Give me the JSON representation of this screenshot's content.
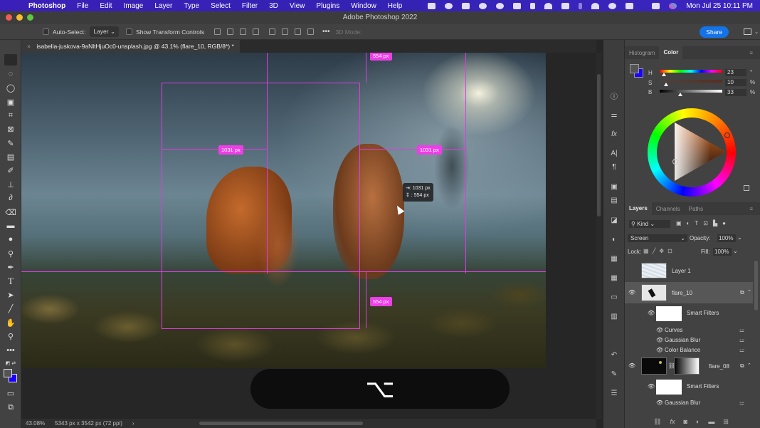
{
  "menubar": {
    "app_name": "Photoshop",
    "items": [
      "File",
      "Edit",
      "Image",
      "Layer",
      "Type",
      "Select",
      "Filter",
      "3D",
      "View",
      "Plugins",
      "Window",
      "Help"
    ],
    "datetime": "Mon Jul 25  10:11 PM"
  },
  "window": {
    "title": "Adobe Photoshop 2022"
  },
  "options_bar": {
    "auto_select_label": "Auto-Select:",
    "auto_select_target": "Layer",
    "show_transform_label": "Show Transform Controls",
    "mode_3d_label": "3D Mode:",
    "share_label": "Share"
  },
  "document": {
    "tab_title": "isabella-juskova-9aNltHjuOc0-unsplash.jpg @ 43.1% (flare_10, RGB/8*) *",
    "close": "×"
  },
  "measurements": {
    "top": "554 px",
    "left": "1031 px",
    "right": "1031 px",
    "bottom": "554 px",
    "tooltip_w": "⇥: 1031 px",
    "tooltip_h": "↧ :  554 px"
  },
  "key_overlay": {
    "glyph": "⌥"
  },
  "statusbar": {
    "zoom": "43.08%",
    "dimensions": "5343 px x 3542 px (72 ppi)",
    "arrow": "›"
  },
  "color_panel": {
    "tabs": [
      "Histogram",
      "Color"
    ],
    "active_tab": "Color",
    "h_label": "H",
    "s_label": "S",
    "b_label": "B",
    "h": "23",
    "s": "10",
    "b": "33",
    "h_unit": "°",
    "s_unit": "%",
    "b_unit": "%",
    "h_fraction": 0.064,
    "s_fraction": 0.1,
    "b_fraction": 0.33,
    "foreground": "#545454",
    "background": "#1a00ff"
  },
  "layers_panel": {
    "tabs": [
      "Layers",
      "Channels",
      "Paths"
    ],
    "active_tab": "Layers",
    "filter_kind": "Kind",
    "blend_mode": "Screen",
    "opacity_label": "Opacity:",
    "opacity": "100%",
    "lock_label": "Lock:",
    "fill_label": "Fill:",
    "fill": "100%",
    "layers": [
      {
        "name": "Layer 1",
        "visible": false
      },
      {
        "name": "flare_10",
        "visible": true,
        "selected": true,
        "smart_filters_label": "Smart Filters",
        "filters": [
          "Curves",
          "Gaussian Blur",
          "Color Balance"
        ]
      },
      {
        "name": "flare_08",
        "visible": true,
        "smart_filters_label": "Smart Filters",
        "filters": [
          "Gaussian Blur"
        ]
      }
    ]
  },
  "colors": {
    "guide": "#e03be0",
    "share": "#1473e6",
    "menubar": "#3422b4"
  }
}
